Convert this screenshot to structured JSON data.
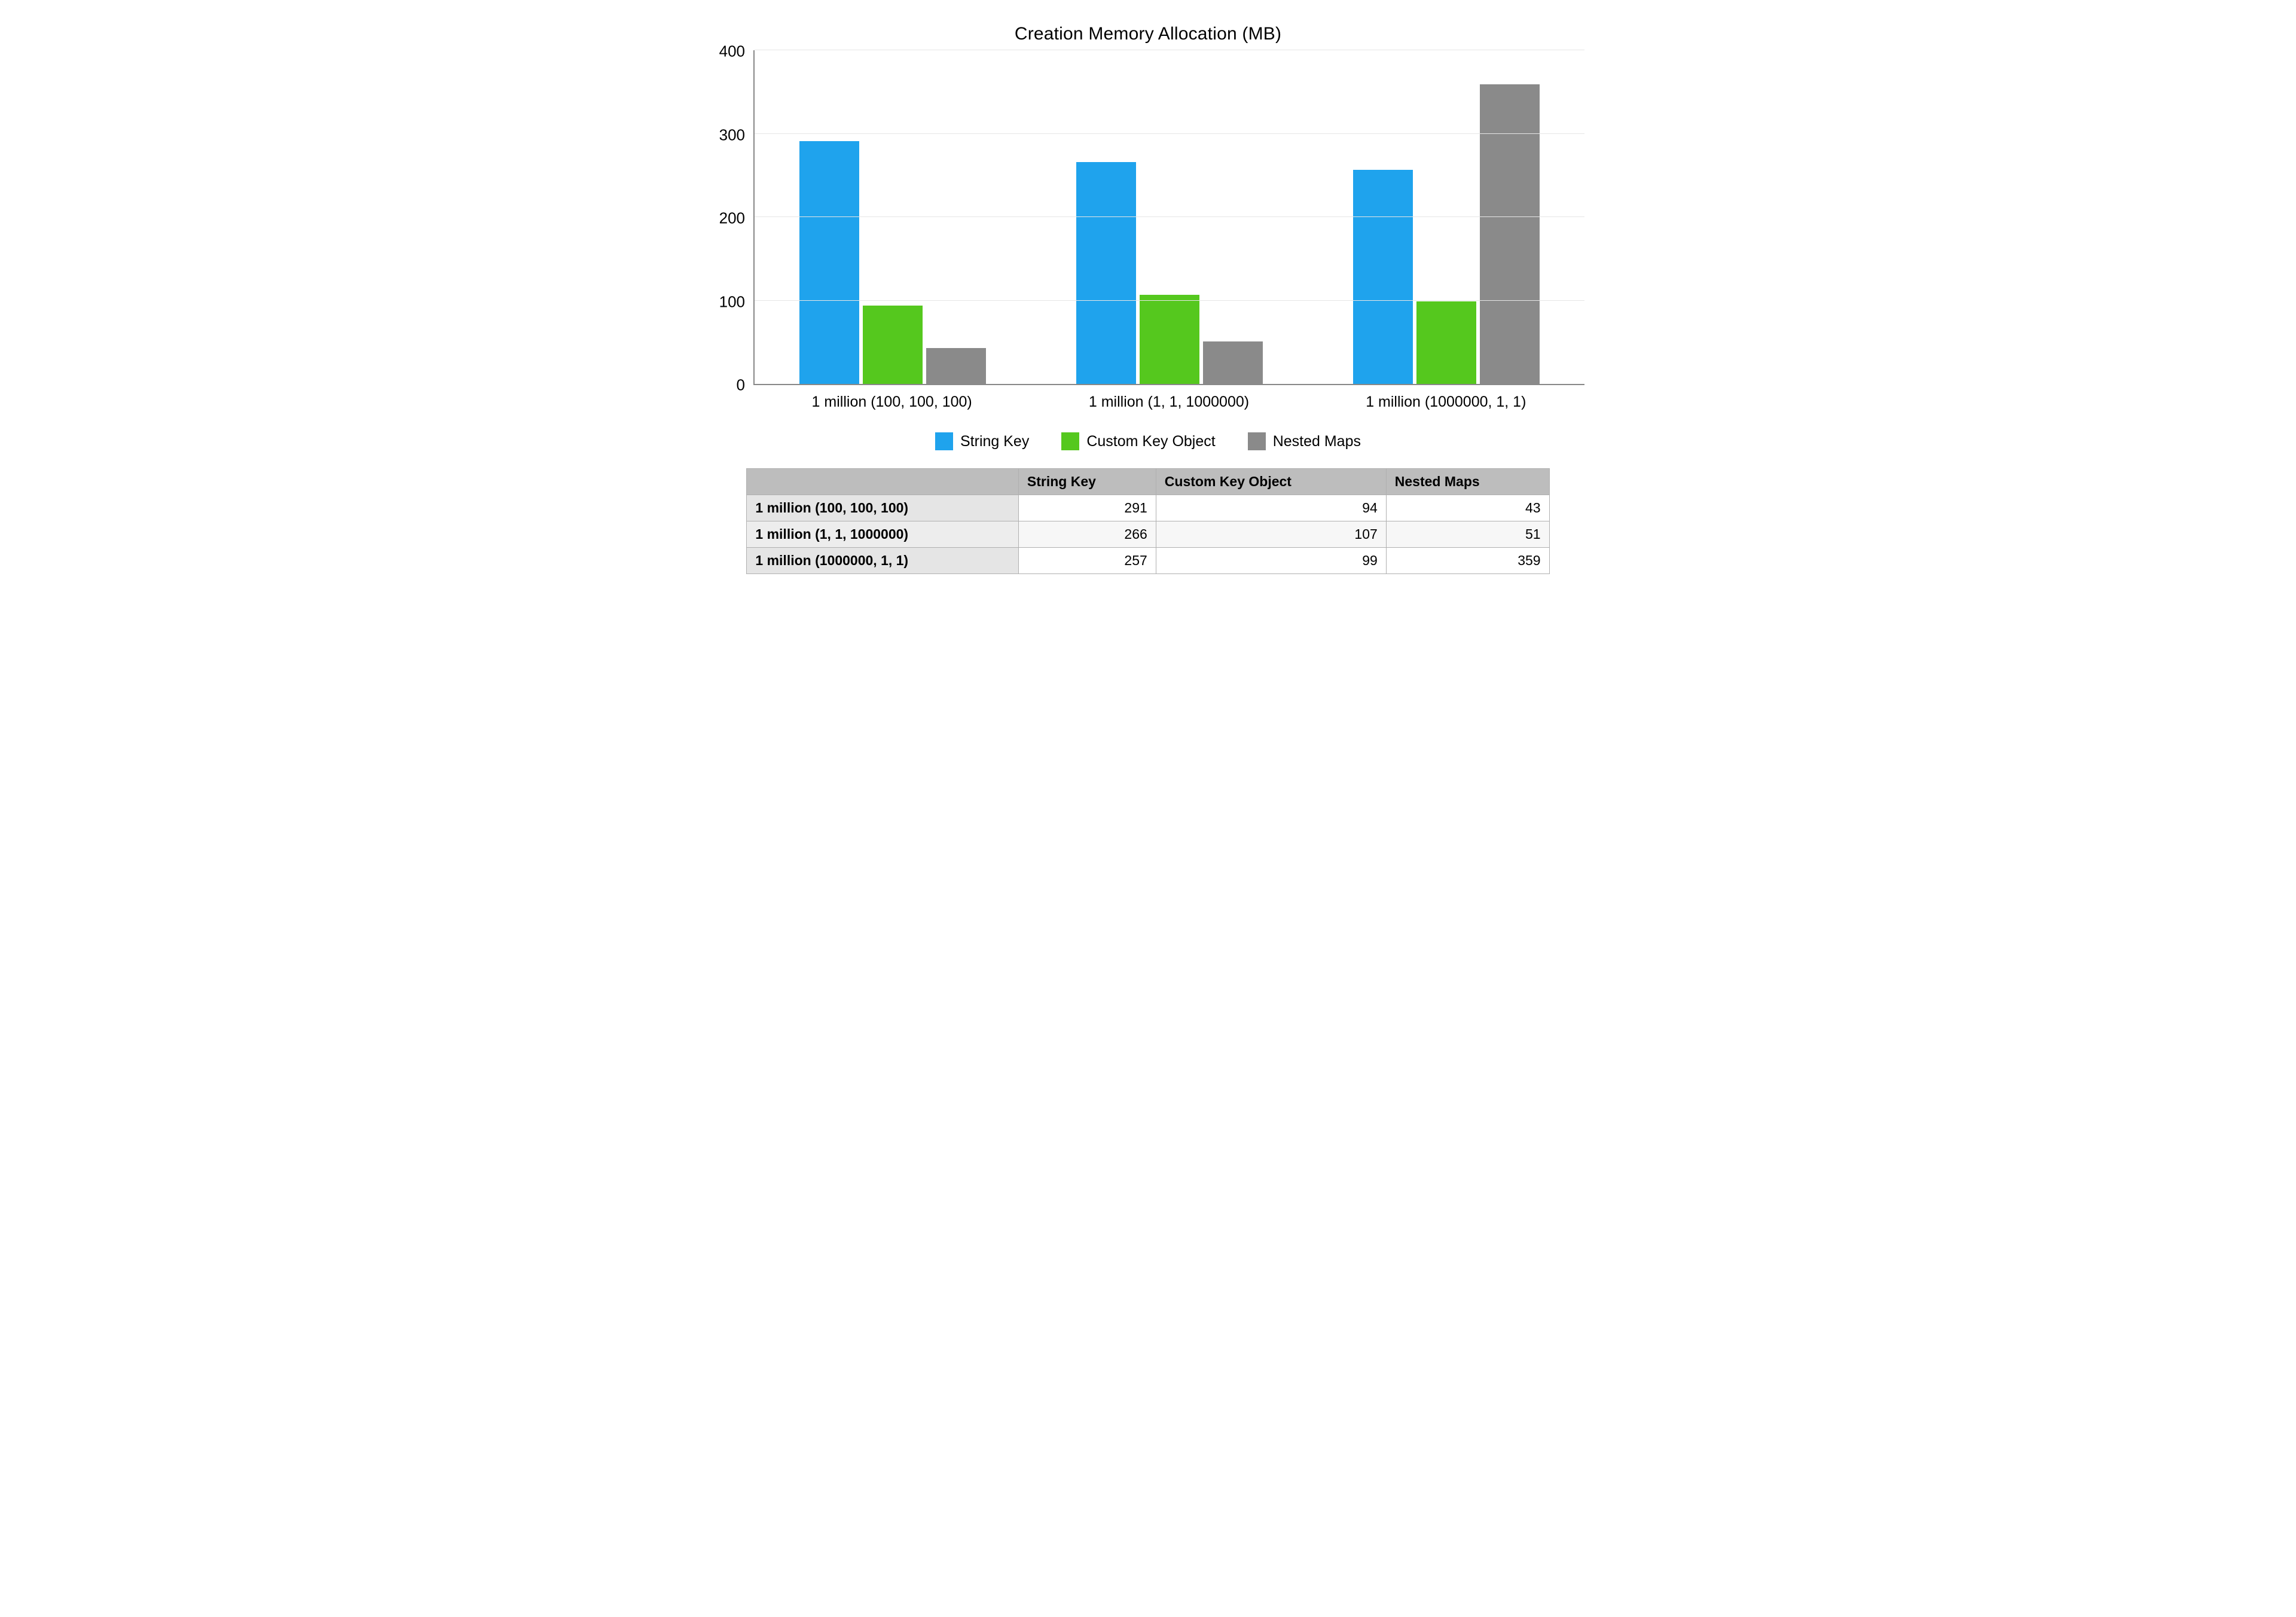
{
  "chart_data": {
    "type": "bar",
    "title": "Creation Memory Allocation (MB)",
    "xlabel": "",
    "ylabel": "",
    "ylim": [
      0,
      400
    ],
    "yticks": [
      0,
      100,
      200,
      300,
      400
    ],
    "categories": [
      "1 million (100, 100, 100)",
      "1 million (1, 1, 1000000)",
      "1 million (1000000, 1, 1)"
    ],
    "series": [
      {
        "name": "String Key",
        "color": "#1fa3ed",
        "values": [
          291,
          266,
          257
        ]
      },
      {
        "name": "Custom Key Object",
        "color": "#55c81e",
        "values": [
          94,
          107,
          99
        ]
      },
      {
        "name": "Nested Maps",
        "color": "#8a8a8a",
        "values": [
          43,
          51,
          359
        ]
      }
    ],
    "legend_position": "bottom",
    "grid": true
  },
  "table": {
    "columns": [
      "String Key",
      "Custom Key Object",
      "Nested Maps"
    ],
    "rows": [
      {
        "label": "1 million (100, 100, 100)",
        "cells": [
          291,
          94,
          43
        ]
      },
      {
        "label": "1 million (1, 1, 1000000)",
        "cells": [
          266,
          107,
          51
        ]
      },
      {
        "label": "1 million (1000000, 1, 1)",
        "cells": [
          257,
          99,
          359
        ]
      }
    ]
  }
}
